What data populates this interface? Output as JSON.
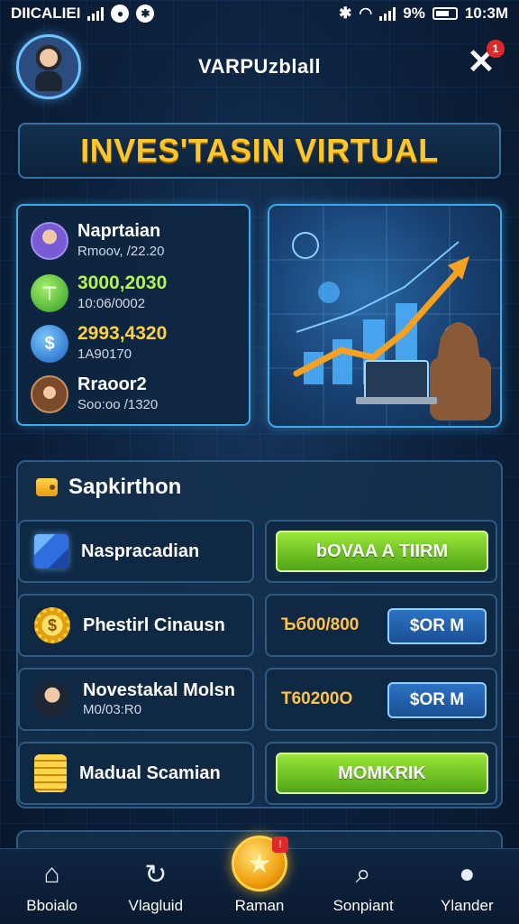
{
  "status_bar": {
    "carrier": "DIICALIEI",
    "battery_percent": "9%",
    "time": "10:3M"
  },
  "header": {
    "title": "VARPUzblall",
    "notification_count": "1"
  },
  "banner": {
    "title": "INVES'TASIN VIRTUAL"
  },
  "stats": [
    {
      "name": "Naprtaian",
      "sub": "Rmoov, /22.20",
      "icon": "person-avatar-icon"
    },
    {
      "name": "3000,2030",
      "sub": "10:06/0002",
      "icon": "green-coin-icon"
    },
    {
      "name": "2993,4320",
      "sub": "1A90170",
      "icon": "dollar-coin-icon"
    },
    {
      "name": "Rraoor2",
      "sub": "Soo:oo /1320",
      "icon": "woman-avatar-icon"
    }
  ],
  "panel": {
    "title": "Sapkirthon",
    "rows": [
      {
        "label": "Naspracadian",
        "sub": "",
        "icon": "cube-icon",
        "button": "bOVAA A TIIRM",
        "button_type": "green"
      },
      {
        "label": "Phestirl Cinausn",
        "sub": "",
        "icon": "gear-coin-icon",
        "amount": "Ъб00/800",
        "button": "$OR M",
        "button_type": "blue"
      },
      {
        "label": "Novestakal Molsn",
        "sub": "M0/03:R0",
        "icon": "businessman-icon",
        "amount": "Т60200O",
        "button": "$OR M",
        "button_type": "blue"
      },
      {
        "label": "Madual Scamian",
        "sub": "",
        "icon": "gold-coins-icon",
        "button": "MOMKRIK",
        "button_type": "green"
      }
    ]
  },
  "bottom_nav": [
    {
      "label": "Bboialo",
      "icon": "home-icon"
    },
    {
      "label": "Vlagluid",
      "icon": "refresh-icon"
    },
    {
      "label": "Raman",
      "icon": "crown-coin-icon"
    },
    {
      "label": "Sonpiant",
      "icon": "search-icon"
    },
    {
      "label": "Ylander",
      "icon": "profile-icon"
    }
  ],
  "colors": {
    "accent_gold": "#ffc629",
    "accent_green": "#9ae63a",
    "accent_blue": "#3da9e8",
    "background": "#0d2340"
  }
}
